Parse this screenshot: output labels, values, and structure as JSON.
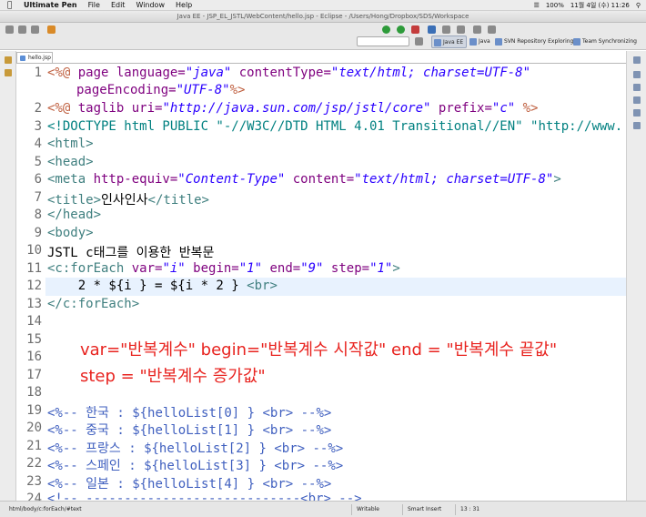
{
  "menubar": {
    "app_name": "Ultimate Pen",
    "items": [
      "File",
      "Edit",
      "Window",
      "Help"
    ],
    "battery": "100%",
    "clock": "11월 4일 (수)  11:26"
  },
  "window": {
    "title": "Java EE - JSP_EL_JSTL/WebContent/hello.jsp - Eclipse - /Users/Hong/Dropbox/SDS/Workspace"
  },
  "toolbar": {
    "perspectives": [
      "Java EE",
      "Java",
      "SVN Repository Exploring",
      "Team Synchronizing"
    ]
  },
  "editor": {
    "tab_label": "hello.jsp",
    "lines": [
      {
        "n": "1"
      },
      {
        "n": ""
      },
      {
        "n": "2"
      },
      {
        "n": "3"
      },
      {
        "n": "4"
      },
      {
        "n": "5"
      },
      {
        "n": "6"
      },
      {
        "n": "7"
      },
      {
        "n": "8"
      },
      {
        "n": "9"
      },
      {
        "n": "10"
      },
      {
        "n": "11"
      },
      {
        "n": "12"
      },
      {
        "n": "13"
      },
      {
        "n": "14"
      },
      {
        "n": "15"
      },
      {
        "n": "16"
      },
      {
        "n": "17"
      },
      {
        "n": "18"
      },
      {
        "n": "19"
      },
      {
        "n": "20"
      },
      {
        "n": "21"
      },
      {
        "n": "22"
      },
      {
        "n": "23"
      },
      {
        "n": "24"
      }
    ],
    "code": {
      "l1a": "<%@ ",
      "l1b": "page ",
      "l1c": "language=",
      "l1d": "\"java\"",
      "l1e": " contentType=",
      "l1f": "\"text/html; charset=UTF-8\"",
      "l1g": "pageEncoding=",
      "l1h": "\"UTF-8\"",
      "l1i": "%>",
      "l2a": "<%@ ",
      "l2b": "taglib ",
      "l2c": "uri=",
      "l2d": "\"http://java.sun.com/jsp/jstl/core\"",
      "l2e": " prefix=",
      "l2f": "\"c\"",
      "l2g": " %>",
      "l3": "<!DOCTYPE html PUBLIC \"-//W3C//DTD HTML 4.01 Transitional//EN\" \"http://www.",
      "l4": "<html>",
      "l5": "<head>",
      "l6a": "<meta ",
      "l6b": "http-equiv=",
      "l6c": "\"Content-Type\"",
      "l6d": " content=",
      "l6e": "\"text/html; charset=UTF-8\"",
      "l6f": ">",
      "l7a": "<title>",
      "l7b": "인사인사",
      "l7c": "</title>",
      "l8": "</head>",
      "l9": "<body>",
      "l10": "JSTL c태그를 이용한 반복문",
      "l11a": "<c:forEach ",
      "l11b": "var=",
      "l11c": "\"i\"",
      "l11d": " begin=",
      "l11e": "\"1\"",
      "l11f": " end=",
      "l11g": "\"9\"",
      "l11h": " step=",
      "l11i": "\"1\"",
      "l11j": ">",
      "l12a": "    2 * ${i } = ${i * 2 } ",
      "l12b": "<br>",
      "l13": "</c:forEach>",
      "l20": "<%-- 한국 : ${helloList[0] } <br> --%>",
      "l21": "<%-- 중국 : ${helloList[1] } <br> --%>",
      "l22": "<%-- 프랑스 : ${helloList[2] } <br> --%>",
      "l23": "<%-- 스페인 : ${helloList[3] } <br> --%>",
      "l24": "<%-- 일본 : ${helloList[4] } <br> --%>",
      "l25": "<!-- ----------------------------<br> -->"
    }
  },
  "annotation": {
    "line1": "var=\"반복계수\" begin=\"반복계수 시작값\" end = \"반복계수 끝값\"",
    "line2": "step = \"반복계수 증가값\""
  },
  "statusbar": {
    "path": "html/body/c:forEach/#text",
    "mode": "Writable",
    "insert": "Smart Insert",
    "position": "13 : 31"
  }
}
